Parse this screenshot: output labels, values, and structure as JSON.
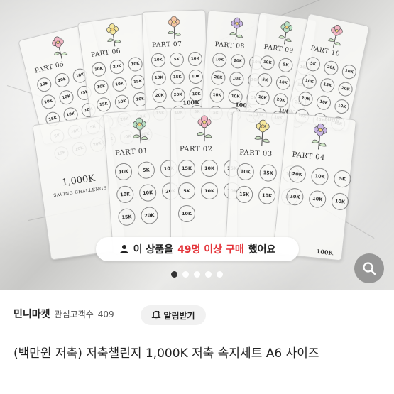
{
  "photo": {
    "back_cards": [
      {
        "part": "PART 05",
        "coins": [
          "10K",
          "20K",
          "10K",
          "10K",
          "10K",
          "15K",
          "15K",
          "10K",
          "10K",
          "5K",
          "20K",
          "5K",
          "15K",
          "10K",
          "20K"
        ]
      },
      {
        "part": "PART 06",
        "coins": [
          "10K",
          "20K",
          "10K",
          "10K",
          "10K",
          "15K",
          "15K",
          "10K",
          "10K",
          "5K",
          "20K",
          "5K",
          "15K",
          "10K",
          "20K"
        ]
      },
      {
        "part": "PART 07",
        "coins": [
          "10K",
          "5K",
          "10K",
          "10K",
          "15K",
          "10K",
          "20K",
          "20K",
          "10K",
          "15K",
          "10K",
          "5K"
        ],
        "total": "100K"
      },
      {
        "part": "PART 08",
        "coins": [
          "10K",
          "20K",
          "10K",
          "20K",
          "10K",
          "10K",
          "10K",
          "10K",
          "5K",
          "5K",
          "10K",
          "10K"
        ],
        "total": "100K"
      },
      {
        "part": "PART 09",
        "coins": [
          "10K",
          "5K",
          "10K",
          "5K",
          "10K",
          "15K",
          "10K",
          "20K",
          "20K",
          "15K",
          "10K",
          "10K"
        ],
        "total": "100K"
      },
      {
        "part": "PART 10",
        "coins": [
          "5K",
          "20K",
          "10K",
          "10K",
          "15K",
          "20K",
          "20K",
          "10K",
          "10K",
          "10K",
          "15K",
          "10K"
        ],
        "total": "100K"
      }
    ],
    "saving_card": {
      "title": "1,000K",
      "subtitle": "SAVING CHALLENGE"
    },
    "front_cards": [
      {
        "part": "PART 01",
        "coins": [
          "10K",
          "5K",
          "10K",
          "10K",
          "10K",
          "20K",
          "15K",
          "20K"
        ]
      },
      {
        "part": "PART 02",
        "coins": [
          "15K",
          "10K",
          "15K",
          "5K",
          "10K",
          "10K",
          "10K"
        ]
      },
      {
        "part": "PART 03",
        "coins": [
          "10K",
          "15K",
          "10K",
          "15K",
          "10K",
          "10K"
        ]
      },
      {
        "part": "PART 04",
        "coins": [
          "20K",
          "10K",
          "5K",
          "10K",
          "10K",
          "10K"
        ],
        "total": "100K"
      }
    ],
    "purchase_pill": {
      "prefix": "이 상품을",
      "highlight": "49명 이상 구매",
      "suffix": "했어요"
    },
    "carousel_dots": 5,
    "carousel_active": 0
  },
  "seller": {
    "name": "민니마켓",
    "followers_label": "관심고객수",
    "followers_count": "409",
    "alert_button": "알림받기"
  },
  "product": {
    "title": "(백만원 저축) 저축챌린지 1,000K 저축 속지세트 A6 사이즈"
  },
  "colors": {
    "highlight": "#e4343a",
    "text": "#222222"
  }
}
